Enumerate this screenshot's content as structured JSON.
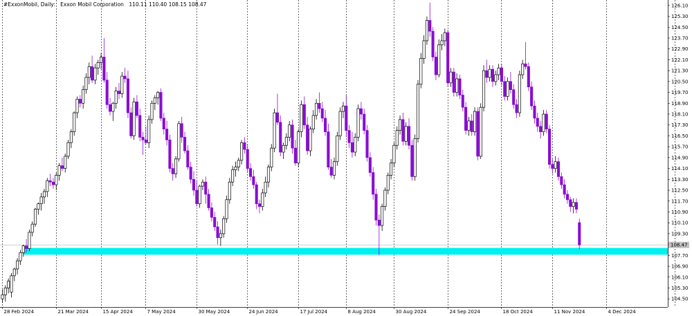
{
  "header": {
    "symbol_label": "#ExxonMobil, Daily:",
    "description": "Exxon Mobil Corporation",
    "ohlc": "110.11 110.40 108.15 108.47"
  },
  "current_price_tag": "108.47",
  "colors": {
    "bull_body": "#ffffff",
    "bull_outline": "#000000",
    "bear_body": "#8a0dd4",
    "zone": "#00f0f0",
    "grid": "#000000",
    "price_line": "#c0c0c0"
  },
  "chart_data": {
    "type": "candlestick",
    "title": "",
    "xlabel": "",
    "ylabel": "",
    "ylim": [
      103.9,
      126.5
    ],
    "grid": "vertical dotted",
    "y_ticks": [
      "126.10",
      "125.30",
      "124.50",
      "123.70",
      "122.90",
      "122.10",
      "121.30",
      "120.50",
      "119.70",
      "118.90",
      "118.10",
      "117.30",
      "116.50",
      "115.70",
      "114.90",
      "114.10",
      "113.30",
      "112.50",
      "111.70",
      "110.90",
      "110.10",
      "109.30",
      "108.50",
      "107.70",
      "106.90",
      "106.10",
      "105.30",
      "104.50"
    ],
    "x_labels": [
      "28 Feb 2024",
      "21 Mar 2024",
      "15 Apr 2024",
      "7 May 2024",
      "30 May 2024",
      "24 Jun 2024",
      "17 Jul 2024",
      "8 Aug 2024",
      "30 Aug 2024",
      "24 Sep 2024",
      "18 Oct 2024",
      "11 Nov 2024",
      "4 Dec 2024"
    ],
    "support_zone": [
      107.75,
      108.25
    ],
    "last_price": 108.47,
    "candles": [
      [
        104.5,
        105.2,
        104.2,
        104.8
      ],
      [
        104.8,
        105.5,
        104.3,
        105.3
      ],
      [
        105.3,
        106.0,
        104.9,
        105.8
      ],
      [
        105.0,
        106.4,
        104.6,
        106.2
      ],
      [
        106.2,
        106.8,
        105.8,
        106.7
      ],
      [
        106.7,
        107.5,
        106.3,
        107.3
      ],
      [
        107.3,
        108.1,
        107.0,
        107.9
      ],
      [
        107.9,
        108.5,
        107.6,
        108.4
      ],
      [
        108.4,
        108.9,
        107.9,
        108.2
      ],
      [
        108.2,
        109.6,
        108.0,
        109.4
      ],
      [
        109.4,
        110.2,
        109.1,
        110.0
      ],
      [
        110.0,
        111.2,
        109.8,
        111.1
      ],
      [
        111.1,
        111.6,
        110.7,
        111.5
      ],
      [
        111.5,
        112.3,
        111.0,
        112.0
      ],
      [
        112.0,
        112.6,
        111.5,
        112.4
      ],
      [
        112.4,
        113.4,
        112.0,
        113.2
      ],
      [
        113.2,
        113.7,
        112.8,
        113.1
      ],
      [
        113.1,
        113.4,
        112.6,
        112.9
      ],
      [
        112.9,
        113.8,
        112.5,
        113.6
      ],
      [
        113.6,
        114.5,
        113.2,
        114.3
      ],
      [
        114.3,
        114.9,
        113.9,
        114.1
      ],
      [
        114.1,
        115.2,
        113.8,
        115.0
      ],
      [
        115.0,
        116.2,
        114.8,
        116.0
      ],
      [
        116.0,
        117.0,
        115.6,
        116.8
      ],
      [
        116.8,
        118.3,
        116.5,
        118.2
      ],
      [
        118.2,
        119.4,
        117.8,
        119.2
      ],
      [
        119.2,
        119.5,
        118.6,
        118.9
      ],
      [
        118.9,
        120.2,
        118.5,
        119.9
      ],
      [
        119.9,
        121.1,
        119.6,
        120.8
      ],
      [
        120.8,
        121.9,
        120.3,
        121.6
      ],
      [
        121.6,
        122.4,
        120.4,
        120.6
      ],
      [
        120.6,
        121.8,
        120.3,
        121.5
      ],
      [
        121.5,
        122.1,
        121.0,
        121.9
      ],
      [
        121.9,
        122.6,
        121.4,
        122.3
      ],
      [
        122.3,
        123.7,
        120.4,
        120.6
      ],
      [
        120.6,
        121.2,
        118.5,
        118.8
      ],
      [
        118.8,
        119.3,
        118.0,
        118.3
      ],
      [
        118.3,
        119.0,
        117.6,
        118.9
      ],
      [
        118.9,
        120.1,
        118.5,
        119.8
      ],
      [
        119.8,
        120.4,
        119.2,
        119.6
      ],
      [
        119.6,
        121.2,
        119.3,
        120.9
      ],
      [
        120.9,
        121.5,
        120.4,
        120.7
      ],
      [
        120.7,
        121.3,
        117.8,
        118.2
      ],
      [
        118.2,
        118.6,
        116.3,
        116.5
      ],
      [
        116.5,
        119.3,
        116.2,
        119.0
      ],
      [
        119.0,
        119.5,
        117.8,
        118.0
      ],
      [
        118.0,
        118.5,
        116.1,
        116.4
      ],
      [
        116.4,
        116.8,
        115.1,
        116.2
      ],
      [
        116.2,
        117.2,
        115.9,
        116.0
      ],
      [
        116.0,
        118.0,
        115.6,
        117.7
      ],
      [
        117.7,
        119.1,
        117.4,
        118.9
      ],
      [
        118.9,
        119.5,
        118.4,
        119.3
      ],
      [
        119.3,
        119.8,
        118.8,
        119.7
      ],
      [
        119.7,
        120.0,
        117.6,
        117.8
      ],
      [
        117.8,
        118.2,
        116.6,
        117.0
      ],
      [
        117.0,
        117.6,
        115.8,
        116.2
      ],
      [
        116.2,
        116.6,
        113.8,
        114.1
      ],
      [
        114.1,
        114.5,
        113.2,
        113.7
      ],
      [
        113.7,
        115.0,
        113.4,
        114.8
      ],
      [
        114.8,
        117.6,
        114.6,
        117.4
      ],
      [
        117.4,
        117.9,
        116.0,
        116.4
      ],
      [
        116.4,
        116.8,
        115.2,
        115.4
      ],
      [
        115.4,
        115.8,
        114.0,
        114.2
      ],
      [
        114.2,
        114.6,
        113.0,
        113.3
      ],
      [
        113.3,
        113.9,
        112.1,
        112.5
      ],
      [
        112.5,
        113.2,
        111.3,
        111.5
      ],
      [
        111.5,
        112.9,
        111.2,
        112.8
      ],
      [
        112.8,
        113.3,
        112.5,
        113.1
      ],
      [
        113.1,
        113.5,
        111.5,
        112.2
      ],
      [
        112.2,
        112.6,
        111.0,
        111.2
      ],
      [
        111.2,
        111.6,
        110.2,
        110.5
      ],
      [
        110.5,
        110.9,
        109.5,
        109.8
      ],
      [
        109.8,
        110.2,
        108.5,
        109.0
      ],
      [
        109.0,
        109.6,
        108.4,
        109.3
      ],
      [
        109.3,
        110.6,
        109.0,
        110.4
      ],
      [
        110.4,
        112.1,
        110.1,
        111.8
      ],
      [
        111.8,
        113.4,
        111.5,
        113.1
      ],
      [
        113.1,
        114.3,
        112.8,
        114.0
      ],
      [
        114.0,
        114.6,
        113.5,
        114.2
      ],
      [
        114.2,
        114.9,
        113.9,
        114.7
      ],
      [
        114.7,
        116.2,
        114.4,
        116.0
      ],
      [
        116.0,
        116.4,
        115.2,
        115.5
      ],
      [
        115.5,
        115.9,
        113.8,
        114.1
      ],
      [
        114.1,
        114.5,
        113.2,
        113.5
      ],
      [
        113.5,
        114.0,
        112.6,
        112.9
      ],
      [
        112.9,
        113.1,
        111.1,
        111.5
      ],
      [
        111.5,
        111.8,
        110.8,
        111.3
      ],
      [
        111.3,
        112.6,
        111.0,
        112.3
      ],
      [
        112.3,
        113.5,
        112.0,
        113.1
      ],
      [
        113.1,
        114.4,
        112.7,
        114.2
      ],
      [
        114.2,
        115.9,
        113.9,
        115.6
      ],
      [
        115.6,
        118.5,
        115.3,
        118.2
      ],
      [
        118.2,
        119.6,
        117.3,
        117.5
      ],
      [
        117.5,
        118.0,
        115.0,
        115.3
      ],
      [
        115.3,
        116.0,
        114.8,
        115.8
      ],
      [
        115.8,
        116.7,
        115.5,
        116.4
      ],
      [
        116.4,
        117.6,
        116.1,
        117.3
      ],
      [
        117.3,
        117.7,
        115.2,
        115.6
      ],
      [
        115.6,
        116.2,
        114.3,
        114.5
      ],
      [
        114.5,
        117.0,
        114.2,
        116.8
      ],
      [
        116.8,
        119.1,
        116.4,
        118.8
      ],
      [
        118.8,
        119.4,
        117.0,
        117.3
      ],
      [
        117.3,
        117.9,
        115.1,
        115.4
      ],
      [
        115.4,
        117.2,
        115.0,
        117.0
      ],
      [
        117.0,
        118.4,
        116.7,
        118.0
      ],
      [
        118.0,
        119.2,
        117.7,
        118.9
      ],
      [
        118.9,
        119.7,
        118.2,
        118.5
      ],
      [
        118.5,
        119.0,
        117.5,
        117.8
      ],
      [
        117.8,
        118.4,
        116.5,
        116.8
      ],
      [
        116.8,
        117.4,
        114.0,
        114.2
      ],
      [
        114.2,
        114.8,
        113.4,
        113.6
      ],
      [
        113.6,
        114.9,
        113.3,
        114.6
      ],
      [
        114.6,
        116.8,
        114.3,
        116.5
      ],
      [
        116.5,
        118.6,
        116.2,
        118.3
      ],
      [
        118.3,
        119.0,
        117.8,
        118.7
      ],
      [
        118.7,
        119.5,
        116.4,
        116.9
      ],
      [
        116.9,
        117.3,
        115.6,
        116.0
      ],
      [
        116.0,
        116.8,
        114.9,
        115.3
      ],
      [
        115.3,
        116.7,
        115.0,
        116.4
      ],
      [
        116.4,
        118.8,
        116.1,
        118.5
      ],
      [
        118.5,
        119.0,
        117.7,
        118.1
      ],
      [
        118.1,
        118.5,
        116.6,
        116.9
      ],
      [
        116.9,
        117.3,
        114.6,
        114.9
      ],
      [
        114.9,
        115.3,
        113.5,
        113.8
      ],
      [
        113.8,
        114.2,
        111.8,
        112.2
      ],
      [
        112.2,
        112.6,
        109.9,
        110.3
      ],
      [
        110.3,
        110.7,
        107.7,
        109.9
      ],
      [
        109.9,
        111.5,
        109.5,
        111.3
      ],
      [
        111.3,
        112.7,
        111.0,
        112.5
      ],
      [
        112.5,
        113.8,
        112.2,
        113.6
      ],
      [
        113.6,
        114.8,
        113.3,
        114.5
      ],
      [
        114.5,
        116.0,
        114.2,
        115.8
      ],
      [
        115.8,
        117.2,
        115.5,
        116.9
      ],
      [
        116.9,
        118.0,
        116.6,
        117.7
      ],
      [
        117.7,
        118.2,
        115.8,
        116.1
      ],
      [
        116.1,
        117.5,
        115.8,
        117.2
      ],
      [
        117.2,
        117.8,
        115.5,
        115.8
      ],
      [
        115.8,
        116.2,
        113.2,
        113.5
      ],
      [
        113.5,
        116.6,
        113.2,
        116.3
      ],
      [
        116.3,
        120.6,
        116.0,
        120.3
      ],
      [
        120.3,
        122.6,
        120.0,
        122.2
      ],
      [
        122.2,
        123.9,
        121.8,
        123.5
      ],
      [
        123.5,
        125.3,
        123.2,
        125.0
      ],
      [
        125.0,
        126.3,
        123.8,
        124.2
      ],
      [
        124.2,
        124.5,
        122.0,
        122.3
      ],
      [
        122.3,
        122.7,
        120.6,
        121.0
      ],
      [
        121.0,
        123.6,
        120.8,
        123.2
      ],
      [
        123.2,
        124.0,
        122.8,
        123.5
      ],
      [
        123.5,
        124.4,
        123.1,
        124.1
      ],
      [
        124.1,
        124.3,
        120.1,
        120.4
      ],
      [
        120.4,
        121.5,
        120.1,
        121.2
      ],
      [
        121.2,
        121.5,
        119.4,
        119.7
      ],
      [
        119.7,
        121.1,
        119.4,
        120.7
      ],
      [
        120.7,
        121.0,
        119.2,
        119.5
      ],
      [
        119.5,
        119.9,
        118.3,
        118.6
      ],
      [
        118.6,
        119.0,
        116.6,
        116.9
      ],
      [
        116.9,
        117.9,
        116.5,
        117.6
      ],
      [
        117.6,
        118.1,
        116.5,
        116.8
      ],
      [
        116.8,
        118.6,
        116.5,
        118.3
      ],
      [
        118.3,
        118.6,
        114.7,
        115.0
      ],
      [
        115.0,
        118.9,
        114.8,
        118.6
      ],
      [
        118.6,
        121.7,
        118.3,
        121.3
      ],
      [
        121.3,
        122.1,
        120.4,
        120.8
      ],
      [
        120.8,
        121.7,
        120.5,
        121.4
      ],
      [
        121.4,
        121.7,
        120.1,
        120.5
      ],
      [
        120.5,
        121.3,
        120.2,
        121.0
      ],
      [
        121.0,
        121.8,
        120.6,
        121.5
      ],
      [
        121.5,
        121.8,
        120.2,
        120.5
      ],
      [
        120.5,
        120.9,
        119.1,
        119.4
      ],
      [
        119.4,
        120.8,
        119.1,
        120.5
      ],
      [
        120.5,
        121.2,
        119.6,
        119.9
      ],
      [
        119.9,
        120.3,
        118.5,
        118.8
      ],
      [
        118.8,
        119.2,
        117.8,
        118.2
      ],
      [
        118.2,
        121.3,
        117.9,
        121.0
      ],
      [
        121.0,
        122.1,
        120.7,
        121.8
      ],
      [
        121.8,
        123.4,
        121.4,
        121.6
      ],
      [
        121.6,
        121.9,
        119.8,
        120.1
      ],
      [
        120.1,
        120.5,
        118.4,
        118.7
      ],
      [
        118.7,
        119.1,
        117.4,
        117.8
      ],
      [
        117.8,
        118.2,
        116.8,
        117.2
      ],
      [
        117.2,
        117.6,
        116.3,
        116.8
      ],
      [
        116.8,
        118.4,
        116.5,
        118.1
      ],
      [
        118.1,
        118.4,
        116.7,
        117.0
      ],
      [
        117.0,
        117.3,
        114.1,
        114.4
      ],
      [
        114.4,
        114.8,
        113.7,
        114.1
      ],
      [
        114.1,
        115.0,
        113.8,
        114.6
      ],
      [
        114.6,
        114.9,
        113.2,
        113.5
      ],
      [
        113.5,
        113.8,
        112.6,
        112.9
      ],
      [
        112.9,
        113.3,
        111.9,
        112.2
      ],
      [
        112.2,
        112.5,
        111.5,
        111.8
      ],
      [
        111.8,
        112.0,
        110.9,
        111.3
      ],
      [
        111.3,
        111.9,
        110.8,
        111.6
      ],
      [
        111.6,
        111.9,
        110.8,
        111.1
      ],
      [
        110.11,
        110.4,
        108.15,
        108.47
      ]
    ]
  }
}
